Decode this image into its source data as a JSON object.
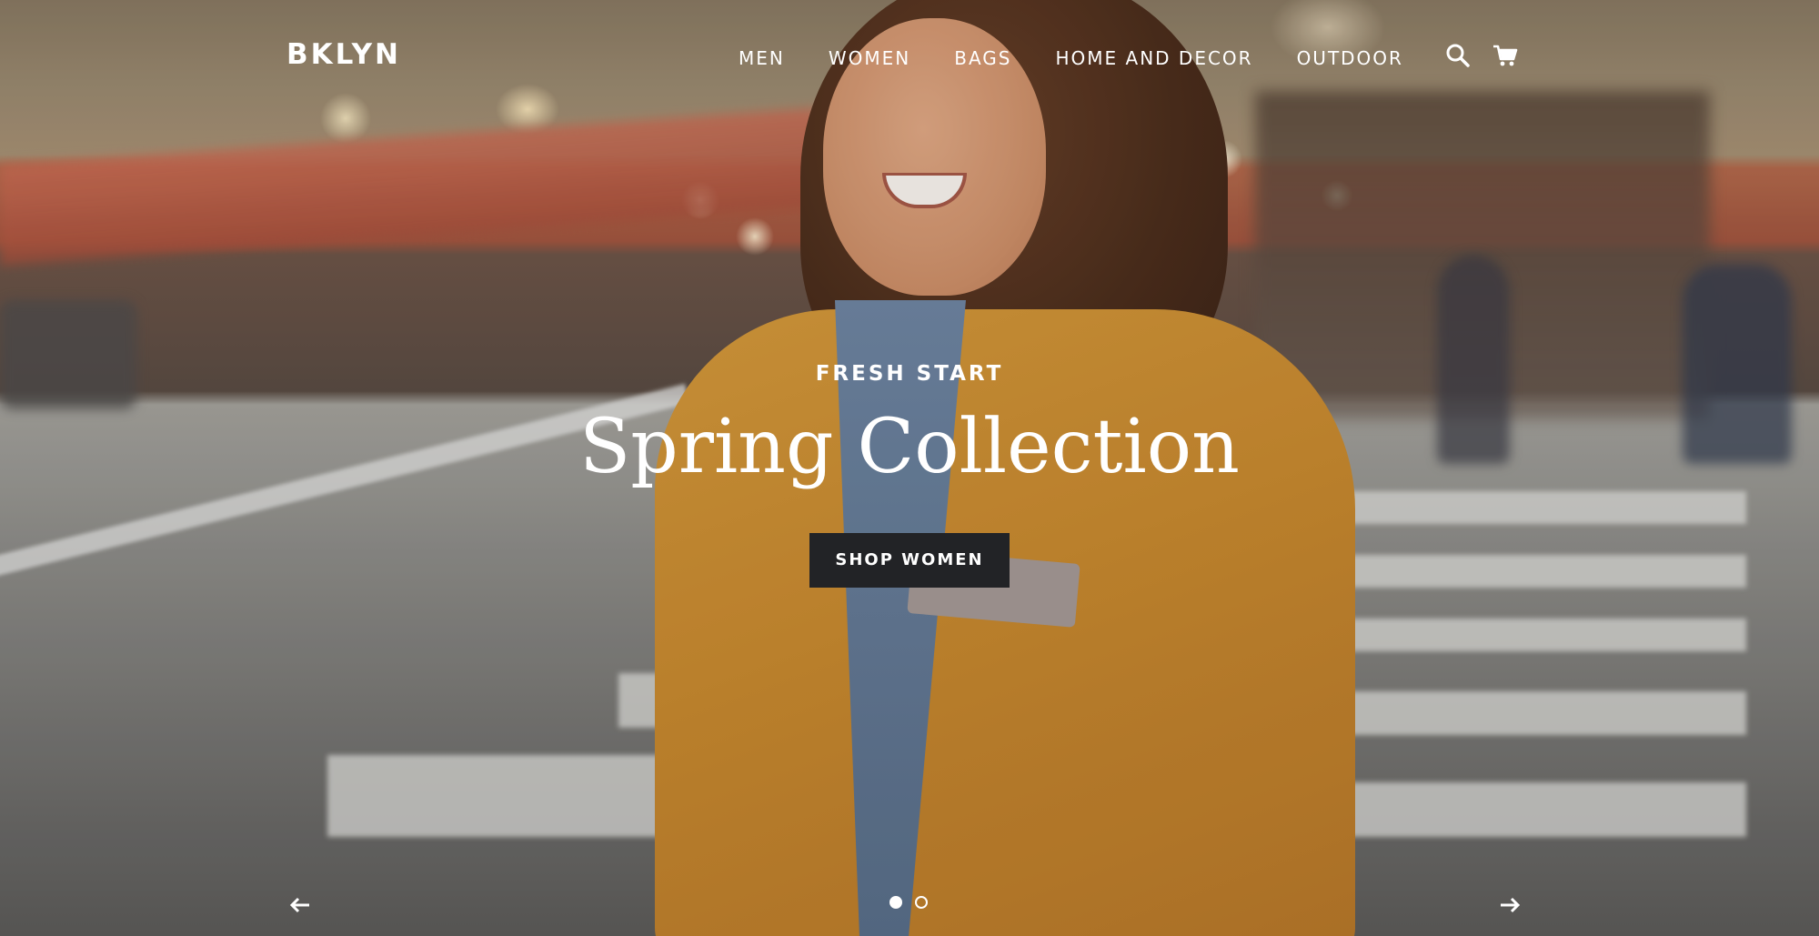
{
  "header": {
    "logo": "BKLYN",
    "nav": [
      {
        "label": "MEN"
      },
      {
        "label": "WOMEN"
      },
      {
        "label": "BAGS"
      },
      {
        "label": "HOME AND DECOR"
      },
      {
        "label": "OUTDOOR"
      }
    ],
    "icons": {
      "search": "search-icon",
      "cart": "cart-icon"
    }
  },
  "hero": {
    "eyebrow": "FRESH START",
    "headline": "Spring Collection",
    "cta_label": "SHOP WOMEN",
    "cta_color": "#222326"
  },
  "slider": {
    "prev_icon": "arrow-left-icon",
    "next_icon": "arrow-right-icon",
    "slide_count": 2,
    "active_slide": 1
  },
  "colors": {
    "text": "#ffffff",
    "button_bg": "#222326"
  }
}
